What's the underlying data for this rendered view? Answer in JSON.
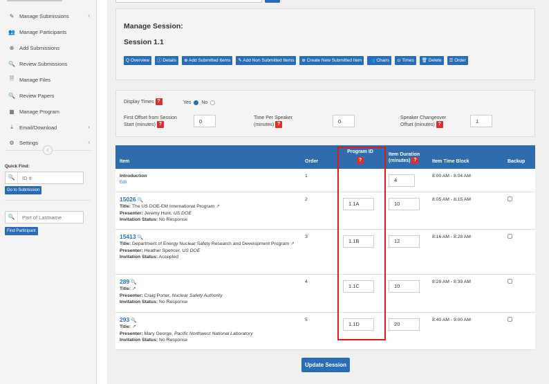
{
  "sidebar": {
    "items": [
      {
        "label": "Manage Submissions",
        "icon": "edit-icon",
        "chevron": true
      },
      {
        "label": "Manage Participants",
        "icon": "users-icon",
        "chevron": false
      },
      {
        "label": "Add Submissions",
        "icon": "plus-circle-icon",
        "chevron": false
      },
      {
        "label": "Review Submissions",
        "icon": "search-icon",
        "chevron": false
      },
      {
        "label": "Manage Files",
        "icon": "file-icon",
        "chevron": false
      },
      {
        "label": "Review Papers",
        "icon": "search-icon",
        "chevron": false
      },
      {
        "label": "Manage Program",
        "icon": "calendar-icon",
        "chevron": false
      },
      {
        "label": "Email/Download",
        "icon": "download-icon",
        "chevron": true
      },
      {
        "label": "Settings",
        "icon": "gears-icon",
        "chevron": true
      }
    ],
    "quick_find_label": "Quick Find:",
    "id_placeholder": "ID #",
    "go_button": "Go to Submission",
    "lastname_placeholder": "Part of Lastname",
    "find_button": "Find Participant"
  },
  "header": {
    "title": "Manage Session:",
    "session": "Session 1.1",
    "buttons": [
      {
        "label": "Q Overview"
      },
      {
        "label": "ⓘ Details"
      },
      {
        "label": "⊕ Add Submitted Items"
      },
      {
        "label": "✎ Add Non Submitted Items"
      },
      {
        "label": "⊕ Create New Submitted Item"
      },
      {
        "label": "👥 Chairs"
      },
      {
        "label": "⊙ Times"
      },
      {
        "label": "🗑 Delete"
      },
      {
        "label": "☰ Order"
      }
    ]
  },
  "settings": {
    "display_times_label": "Display Times",
    "yes_label": "Yes",
    "no_label": "No",
    "first_offset_label_1": "First Offset from Session",
    "first_offset_label_2": "Start (minutes)",
    "first_offset_value": "0",
    "time_per_speaker_label_1": "Time Per Speaker",
    "time_per_speaker_label_2": "(minutes)",
    "time_per_speaker_value": "0",
    "changeover_label_1": "Speaker Changeover",
    "changeover_label_2": "Offset (minutes)",
    "changeover_value": "1",
    "help_glyph": "?"
  },
  "table": {
    "headers": {
      "item": "Item",
      "order": "Order",
      "program_id": "Program ID",
      "duration_1": "Item Duration",
      "duration_2": "(minutes)",
      "time_block": "Item Time Block",
      "backup": "Backup"
    },
    "rows": [
      {
        "intro": "Introduction",
        "edit": "Edit",
        "order": "1",
        "program_id": "",
        "duration": "4",
        "time_block": "8:00 AM - 8:04 AM"
      },
      {
        "id": "15026",
        "title_label": "Title:",
        "title": "The US DOE-EM International Program",
        "presenter_label": "Presenter:",
        "presenter": "Jeremy Hunt,",
        "affiliation": "US DOE",
        "status_label": "Invitation Status:",
        "status": "No Response",
        "order": "2",
        "program_id": "1.1A",
        "duration": "10",
        "time_block": "8:05 AM - 8:15 AM"
      },
      {
        "id": "15413",
        "title_label": "Title:",
        "title": "Department of Energy Nuclear Safety Research and Development Program",
        "presenter_label": "Presenter:",
        "presenter": "Heather Spencer,",
        "affiliation": "US DOE",
        "status_label": "Invitation Status:",
        "status": "Accepted",
        "order": "3",
        "program_id": "1.1B",
        "duration": "12",
        "time_block": "8:16 AM - 8:28 AM"
      },
      {
        "id": "289",
        "title_label": "Title:",
        "title": "",
        "presenter_label": "Presenter:",
        "presenter": "Craig Porter,",
        "affiliation": "Nuclear Safety Authority",
        "status_label": "Invitation Status:",
        "status": "No Response",
        "order": "4",
        "program_id": "1.1C",
        "duration": "10",
        "time_block": "8:29 AM - 8:39 AM"
      },
      {
        "id": "293",
        "title_label": "Title:",
        "title": "",
        "presenter_label": "Presenter:",
        "presenter": "Mary George,",
        "affiliation": "Pacific Northwest National Laboratory",
        "status_label": "Invitation Status:",
        "status": "No Response",
        "order": "5",
        "program_id": "1.1D",
        "duration": "20",
        "time_block": "8:40 AM - 9:00 AM"
      }
    ]
  },
  "update_button": "Update Session",
  "colors": {
    "primary": "#2a6db7",
    "header": "#2f6cae",
    "highlight": "#e0171a",
    "help": "#d9302c"
  }
}
